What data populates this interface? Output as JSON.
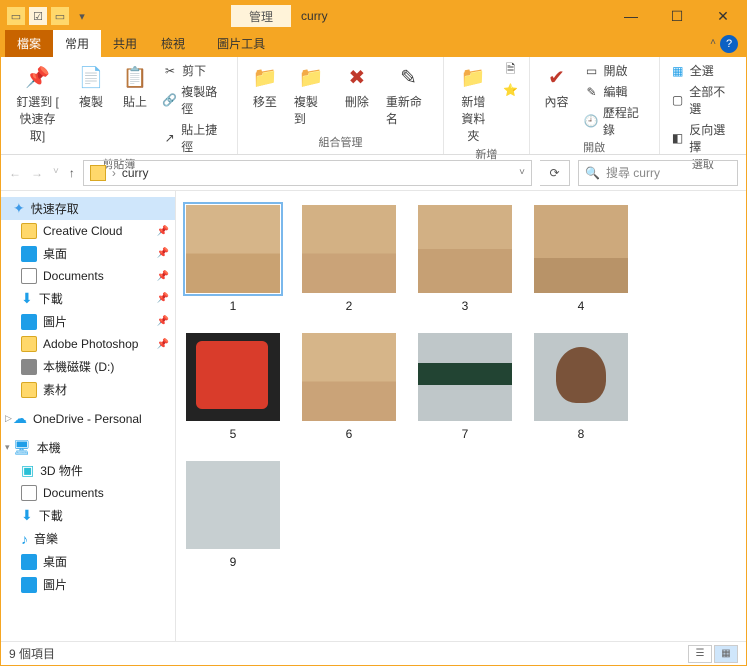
{
  "window": {
    "context_tab": "管理",
    "title": "curry"
  },
  "tabs": {
    "file": "檔案",
    "home": "常用",
    "share": "共用",
    "view": "檢視",
    "picture_tools": "圖片工具"
  },
  "ribbon": {
    "clipboard": {
      "label": "剪貼簿",
      "pin": "釘選到 [\n快速存取]",
      "copy": "複製",
      "paste": "貼上",
      "cut": "剪下",
      "copy_path": "複製路徑",
      "paste_shortcut": "貼上捷徑"
    },
    "organize": {
      "label": "組合管理",
      "move_to": "移至",
      "copy_to": "複製到",
      "delete": "刪除",
      "rename": "重新命名"
    },
    "new": {
      "label": "新增",
      "new_folder": "新增\n資料夾"
    },
    "open": {
      "label": "開啟",
      "properties": "內容",
      "open": "開啟",
      "edit": "編輯",
      "history": "歷程記錄"
    },
    "select": {
      "label": "選取",
      "select_all": "全選",
      "select_none": "全部不選",
      "invert": "反向選擇"
    }
  },
  "nav": {
    "path": "curry",
    "search_placeholder": "搜尋 curry"
  },
  "sidebar": {
    "quick_access": "快速存取",
    "items": [
      {
        "label": "Creative Cloud",
        "icon": "folder",
        "pin": true
      },
      {
        "label": "桌面",
        "icon": "blue",
        "pin": true
      },
      {
        "label": "Documents",
        "icon": "doc",
        "pin": true
      },
      {
        "label": "下載",
        "icon": "arrow",
        "pin": true
      },
      {
        "label": "圖片",
        "icon": "blue",
        "pin": true
      },
      {
        "label": "Adobe Photoshop",
        "icon": "folder",
        "pin": true
      },
      {
        "label": "本機磁碟 (D:)",
        "icon": "disk",
        "pin": false
      },
      {
        "label": "素材",
        "icon": "folder",
        "pin": false
      }
    ],
    "onedrive": "OneDrive - Personal",
    "this_pc": "本機",
    "pc_items": [
      {
        "label": "3D 物件",
        "icon": "cube"
      },
      {
        "label": "Documents",
        "icon": "doc"
      },
      {
        "label": "下載",
        "icon": "arrow"
      },
      {
        "label": "音樂",
        "icon": "music"
      },
      {
        "label": "桌面",
        "icon": "blue"
      },
      {
        "label": "圖片",
        "icon": "blue"
      }
    ]
  },
  "files": [
    {
      "name": "1",
      "cls": "p1",
      "sel": true
    },
    {
      "name": "2",
      "cls": "p2"
    },
    {
      "name": "3",
      "cls": "p3"
    },
    {
      "name": "4",
      "cls": "p4"
    },
    {
      "name": "5",
      "cls": "p5"
    },
    {
      "name": "6",
      "cls": "p6"
    },
    {
      "name": "7",
      "cls": "p7"
    },
    {
      "name": "8",
      "cls": "p8"
    },
    {
      "name": "9",
      "cls": "p9"
    }
  ],
  "status": {
    "count": "9 個項目"
  }
}
